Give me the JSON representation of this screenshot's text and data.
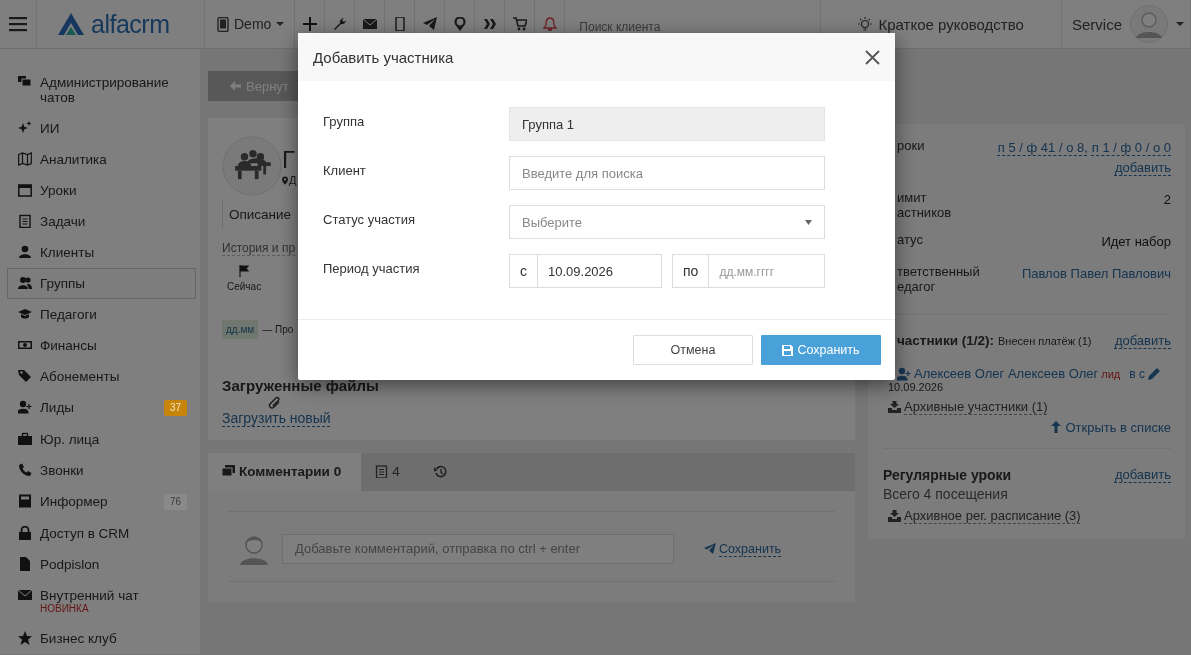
{
  "topbar": {
    "brand": "alfacrm",
    "branch": "Demo",
    "search_placeholder": "Поиск клиента",
    "guide": "Краткое руководство",
    "user": "Service"
  },
  "sidebar": {
    "items": [
      {
        "label": "Администрирование чатов",
        "selected": false
      },
      {
        "label": "ИИ",
        "selected": false
      },
      {
        "label": "Аналитика",
        "selected": false
      },
      {
        "label": "Уроки",
        "selected": false
      },
      {
        "label": "Задачи",
        "selected": false
      },
      {
        "label": "Клиенты",
        "selected": false
      },
      {
        "label": "Группы",
        "selected": true
      },
      {
        "label": "Педагоги",
        "selected": false
      },
      {
        "label": "Финансы",
        "selected": false
      },
      {
        "label": "Абонементы",
        "selected": false
      },
      {
        "label": "Лиды",
        "selected": false,
        "badge": {
          "text": "37",
          "color": "#c7860b"
        }
      },
      {
        "label": "Юр. лица",
        "selected": false
      },
      {
        "label": "Звонки",
        "selected": false
      },
      {
        "label": "Информер",
        "selected": false,
        "badge": {
          "text": "76",
          "color": "#8a8a8a"
        }
      },
      {
        "label": "Доступ в CRM",
        "selected": false
      },
      {
        "label": "Podpislon",
        "selected": false
      },
      {
        "label": "Внутренний чат",
        "selected": false,
        "note": "НОВИНКА"
      },
      {
        "label": "Бизнес клуб",
        "selected": false
      }
    ]
  },
  "group": {
    "back": "Вернут",
    "title": "Г",
    "location": "Д",
    "description_tab": "Описание",
    "history_link": "История и пр",
    "timeline_now": "Сейчас",
    "date_tag": "дд.мм",
    "date_text": "— Про",
    "files_title": "Загруженные файлы",
    "upload_link": "Загрузить новый"
  },
  "tabs": [
    {
      "label": "Комментарии 0",
      "kind": "comments",
      "selected": true
    },
    {
      "label": "4",
      "kind": "tasks",
      "selected": false
    },
    {
      "kind": "history",
      "selected": false
    }
  ],
  "comment": {
    "placeholder": "Добавьте комментарий, отправка по ctrl + enter",
    "send": "Сохранить"
  },
  "details": {
    "rows": [
      {
        "label": "роки",
        "kind": "links",
        "values": [
          "п 5 / ф 41 / о 8,",
          "п 1 / ф 0 / о 0",
          "добавить"
        ]
      },
      {
        "label": "имит астников",
        "kind": "text",
        "value": "2"
      },
      {
        "label": "атус",
        "kind": "text",
        "value": "Идет набор"
      },
      {
        "label": "тветственный едагог",
        "kind": "link",
        "value": "Павлов Павел Павлович"
      }
    ]
  },
  "participants": {
    "title": "частники (1/2):",
    "summary": "Внесен платёж (1)",
    "add": "добавить",
    "members": [
      {
        "name": "Алексеев Олег Алексеев Олег",
        "tag": "лид",
        "status": "в с",
        "date": "10.09.2026"
      }
    ],
    "archive": "Архивные участники (1)",
    "open_list": "Открыть в списке"
  },
  "regular": {
    "title": "Регулярные уроки",
    "add": "добавить",
    "summary": "Всего 4 посещения",
    "archive": "Архивное рег. расписание (3)"
  },
  "modal": {
    "title": "Добавить участника",
    "fields": [
      {
        "label": "Группа",
        "kind": "static",
        "value": "Группа 1"
      },
      {
        "label": "Клиент",
        "kind": "text",
        "placeholder": "Введите для поиска"
      },
      {
        "label": "Статус участия",
        "kind": "select",
        "placeholder": "Выберите"
      },
      {
        "label": "Период участия",
        "kind": "period",
        "from_prefix": "с",
        "from_value": "10.09.2026",
        "to_prefix": "по",
        "to_placeholder": "дд.мм.гггг"
      }
    ],
    "buttons": [
      {
        "label": "Отмена",
        "kind": "cancel"
      },
      {
        "label": "Сохранить",
        "kind": "save"
      }
    ]
  }
}
